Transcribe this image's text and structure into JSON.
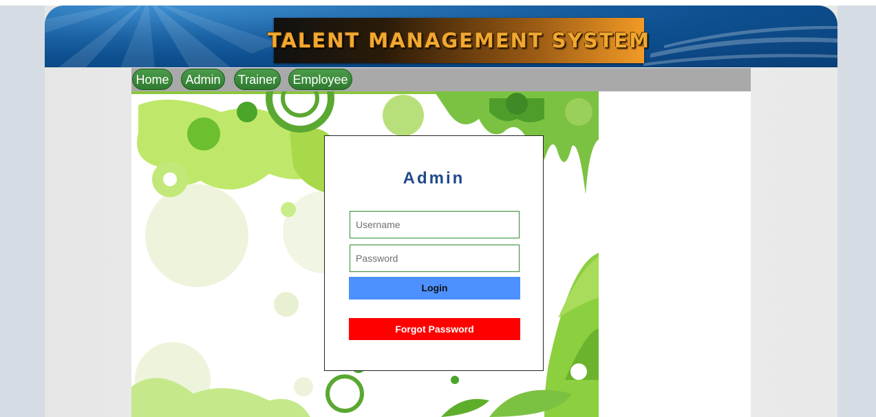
{
  "header": {
    "banner_text": "TALENT MANAGEMENT SYSTEM"
  },
  "nav": {
    "items": [
      {
        "label": "Home"
      },
      {
        "label": "Admin"
      },
      {
        "label": "Trainer"
      },
      {
        "label": "Employee"
      }
    ]
  },
  "login": {
    "title": "Admin",
    "username_placeholder": "Username",
    "password_placeholder": "Password",
    "login_label": "Login",
    "forgot_label": "Forgot Password"
  },
  "colors": {
    "header_blue": "#0d4f8f",
    "nav_green": "#3b8a3b",
    "login_button": "#4d90fe",
    "forgot_button": "#ff0000",
    "title_color": "#1e4a8a"
  }
}
